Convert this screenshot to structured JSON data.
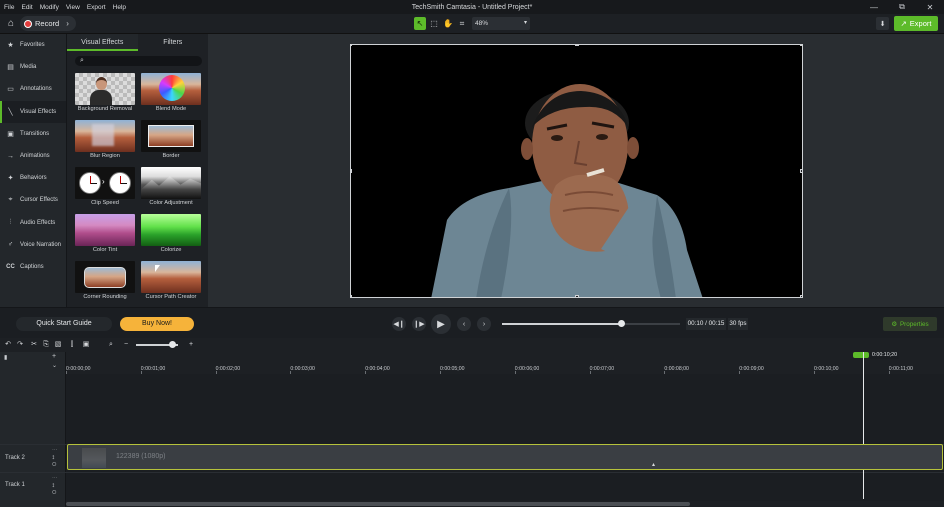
{
  "app": {
    "title": "TechSmith Camtasia - Untitled Project*",
    "menu": [
      "File",
      "Edit",
      "Modify",
      "View",
      "Export",
      "Help"
    ],
    "window_controls": [
      "—",
      "⧉",
      "✕"
    ]
  },
  "toolbar": {
    "record_label": "Record",
    "zoom_value": "48%",
    "export_label": "Export",
    "tools": [
      "select-tool",
      "crop-handles-tool",
      "hand-tool",
      "crop-tool"
    ],
    "accent_color": "#5dbb2a"
  },
  "sidebar": {
    "items": [
      {
        "label": "Favorites",
        "icon": "star-icon"
      },
      {
        "label": "Media",
        "icon": "film-icon"
      },
      {
        "label": "Annotations",
        "icon": "annotation-icon"
      },
      {
        "label": "Visual Effects",
        "icon": "wand-icon",
        "active": true
      },
      {
        "label": "Transitions",
        "icon": "transition-icon"
      },
      {
        "label": "Animations",
        "icon": "animation-icon"
      },
      {
        "label": "Behaviors",
        "icon": "behavior-icon"
      },
      {
        "label": "Cursor Effects",
        "icon": "cursor-icon"
      },
      {
        "label": "Audio Effects",
        "icon": "audio-icon"
      },
      {
        "label": "Voice Narration",
        "icon": "mic-icon"
      },
      {
        "label": "Captions",
        "icon": "cc-icon"
      }
    ]
  },
  "panel": {
    "tabs": [
      "Visual Effects",
      "Filters"
    ],
    "active_tab": "Visual Effects",
    "search_placeholder": "",
    "effects": [
      {
        "label": "Background Removal"
      },
      {
        "label": "Blend Mode"
      },
      {
        "label": "Blur Region"
      },
      {
        "label": "Border"
      },
      {
        "label": "Clip Speed"
      },
      {
        "label": "Color Adjustment"
      },
      {
        "label": "Color Tint"
      },
      {
        "label": "Colorize"
      },
      {
        "label": "Corner Rounding"
      },
      {
        "label": "Cursor Path Creator"
      }
    ]
  },
  "playback": {
    "quick_start_label": "Quick Start Guide",
    "buy_label": "Buy Now!",
    "time": "00:10 / 00:15",
    "fps": "30 fps",
    "progress_fraction": 0.667,
    "properties_label": "Properties"
  },
  "timeline": {
    "zoom_fraction": 0.86,
    "playhead_time": "0:00:10;20",
    "ticks": [
      "0:00:00;00",
      "0:00:01;00",
      "0:00:02;00",
      "0:00:03;00",
      "0:00:04;00",
      "0:00:05;00",
      "0:00:06;00",
      "0:00:07;00",
      "0:00:08;00",
      "0:00:09;00",
      "0:00:10;00",
      "0:00:11;00"
    ],
    "tracks": [
      {
        "name": "Track 2",
        "clip": "122389 (1080p)"
      },
      {
        "name": "Track 1",
        "clip": ""
      }
    ]
  }
}
